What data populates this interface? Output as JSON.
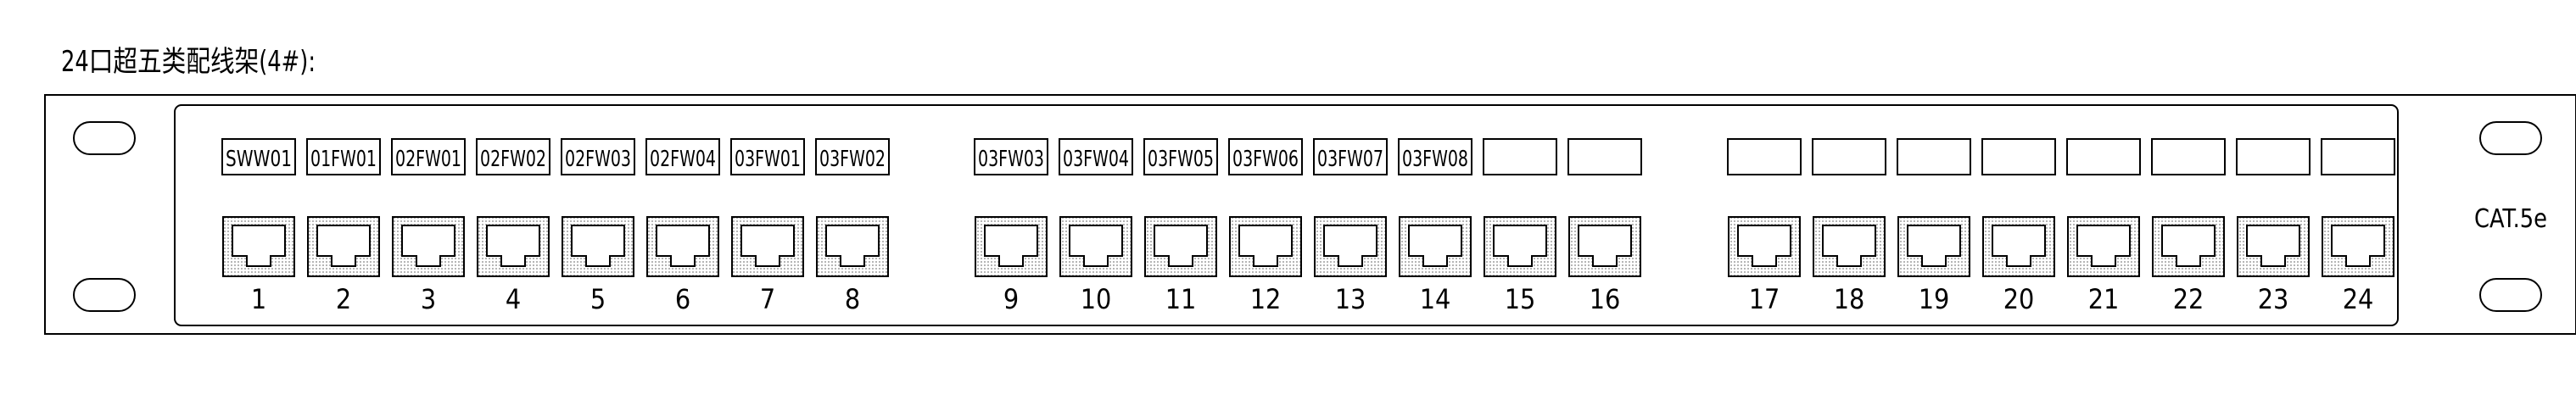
{
  "title": "24口超五类配线架(4#):",
  "side_label": "CAT.5e",
  "ports": [
    {
      "number": "1",
      "label": "SWW01"
    },
    {
      "number": "2",
      "label": "01FW01"
    },
    {
      "number": "3",
      "label": "02FW01"
    },
    {
      "number": "4",
      "label": "02FW02"
    },
    {
      "number": "5",
      "label": "02FW03"
    },
    {
      "number": "6",
      "label": "02FW04"
    },
    {
      "number": "7",
      "label": "03FW01"
    },
    {
      "number": "8",
      "label": "03FW02"
    },
    {
      "number": "9",
      "label": "03FW03"
    },
    {
      "number": "10",
      "label": "03FW04"
    },
    {
      "number": "11",
      "label": "03FW05"
    },
    {
      "number": "12",
      "label": "03FW06"
    },
    {
      "number": "13",
      "label": "03FW07"
    },
    {
      "number": "14",
      "label": "03FW08"
    },
    {
      "number": "15",
      "label": ""
    },
    {
      "number": "16",
      "label": ""
    },
    {
      "number": "17",
      "label": ""
    },
    {
      "number": "18",
      "label": ""
    },
    {
      "number": "19",
      "label": ""
    },
    {
      "number": "20",
      "label": ""
    },
    {
      "number": "21",
      "label": ""
    },
    {
      "number": "22",
      "label": ""
    },
    {
      "number": "23",
      "label": ""
    },
    {
      "number": "24",
      "label": ""
    }
  ]
}
